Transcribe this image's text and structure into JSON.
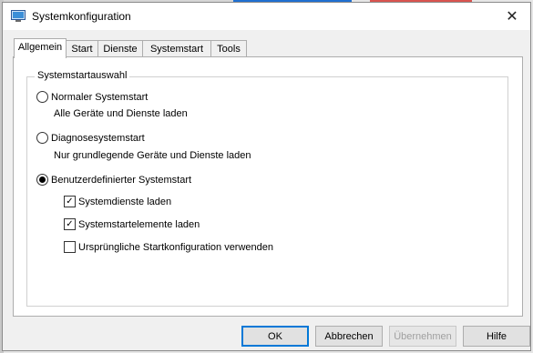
{
  "window": {
    "title": "Systemkonfiguration",
    "close_glyph": "✕"
  },
  "tabs": [
    {
      "label": "Allgemein",
      "active": true
    },
    {
      "label": "Start",
      "active": false
    },
    {
      "label": "Dienste",
      "active": false
    },
    {
      "label": "Systemstart",
      "active": false
    },
    {
      "label": "Tools",
      "active": false
    }
  ],
  "group": {
    "legend": "Systemstartauswahl",
    "options": [
      {
        "label": "Normaler Systemstart",
        "description": "Alle Geräte und Dienste laden",
        "selected": false
      },
      {
        "label": "Diagnosesystemstart",
        "description": "Nur grundlegende Geräte und Dienste laden",
        "selected": false
      },
      {
        "label": "Benutzerdefinierter Systemstart",
        "selected": true
      }
    ],
    "checkboxes": [
      {
        "label": "Systemdienste laden",
        "checked": true
      },
      {
        "label": "Systemstartelemente laden",
        "checked": true
      },
      {
        "label": "Ursprüngliche Startkonfiguration verwenden",
        "checked": false
      }
    ]
  },
  "buttons": {
    "ok": "OK",
    "cancel": "Abbrechen",
    "apply": "Übernehmen",
    "help": "Hilfe"
  },
  "check_glyph": "✓",
  "colors": {
    "accent": "#0078d7",
    "window_bg": "#f0f0f0",
    "panel_bg": "#ffffff"
  }
}
